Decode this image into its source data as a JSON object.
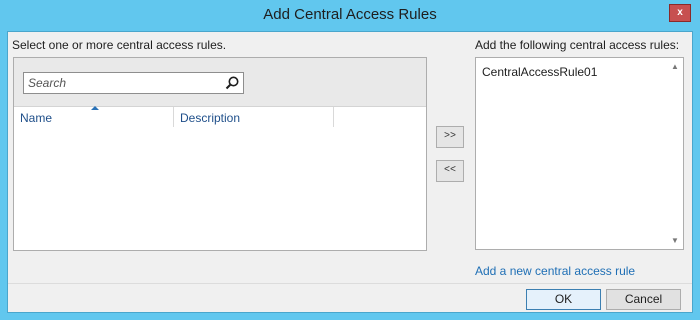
{
  "window": {
    "title": "Add Central Access Rules",
    "close_label": "x"
  },
  "left": {
    "label": "Select one or more central access rules.",
    "search_placeholder": "Search",
    "columns": [
      "Name",
      "Description"
    ]
  },
  "middle": {
    "add_label": ">>",
    "remove_label": "<<"
  },
  "right": {
    "label": "Add the following central access rules:",
    "items": [
      "CentralAccessRule01"
    ]
  },
  "link_label": "Add a new central access rule",
  "footer": {
    "ok_label": "OK",
    "cancel_label": "Cancel"
  },
  "colors": {
    "title_bar": "#61c7ee",
    "link": "#1f6fb5",
    "close": "#c75050"
  }
}
